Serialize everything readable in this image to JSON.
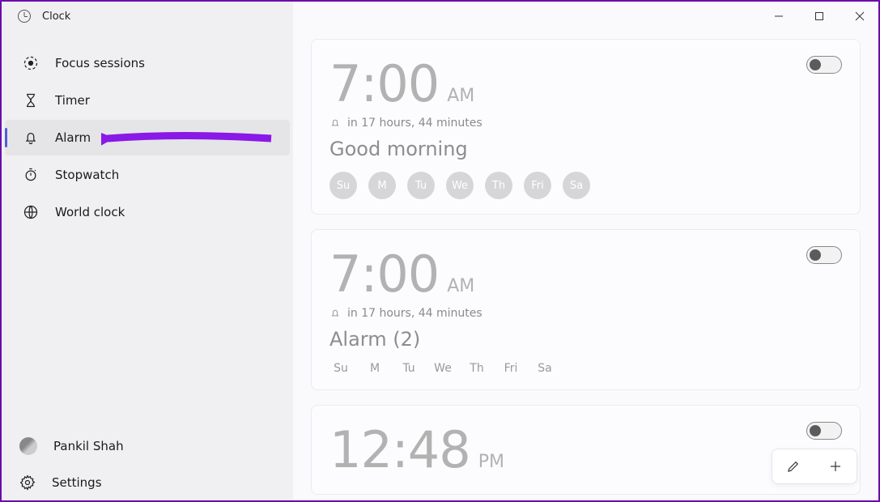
{
  "app_title": "Clock",
  "sidebar": {
    "items": [
      {
        "label": "Focus sessions",
        "name": "sidebar-item-focus-sessions"
      },
      {
        "label": "Timer",
        "name": "sidebar-item-timer"
      },
      {
        "label": "Alarm",
        "name": "sidebar-item-alarm"
      },
      {
        "label": "Stopwatch",
        "name": "sidebar-item-stopwatch"
      },
      {
        "label": "World clock",
        "name": "sidebar-item-world-clock"
      }
    ],
    "selected_index": 2,
    "user": "Pankil Shah",
    "settings_label": "Settings"
  },
  "alarms": [
    {
      "time": "7:00",
      "ampm": "AM",
      "countdown": "in 17 hours, 44 minutes",
      "label": "Good morning",
      "days_style": "pill",
      "days": [
        "Su",
        "M",
        "Tu",
        "We",
        "Th",
        "Fri",
        "Sa"
      ],
      "enabled": false
    },
    {
      "time": "7:00",
      "ampm": "AM",
      "countdown": "in 17 hours, 44 minutes",
      "label": "Alarm (2)",
      "days_style": "text",
      "days": [
        "Su",
        "M",
        "Tu",
        "We",
        "Th",
        "Fri",
        "Sa"
      ],
      "enabled": false
    },
    {
      "time": "12:48",
      "ampm": "PM",
      "countdown": "",
      "label": "",
      "days_style": "none",
      "days": [],
      "enabled": false
    }
  ],
  "fab": {
    "edit": "edit-icon",
    "add": "add-icon"
  },
  "annotation": {
    "arrow_target": "Alarm",
    "arrow_color": "#8a18e6"
  }
}
